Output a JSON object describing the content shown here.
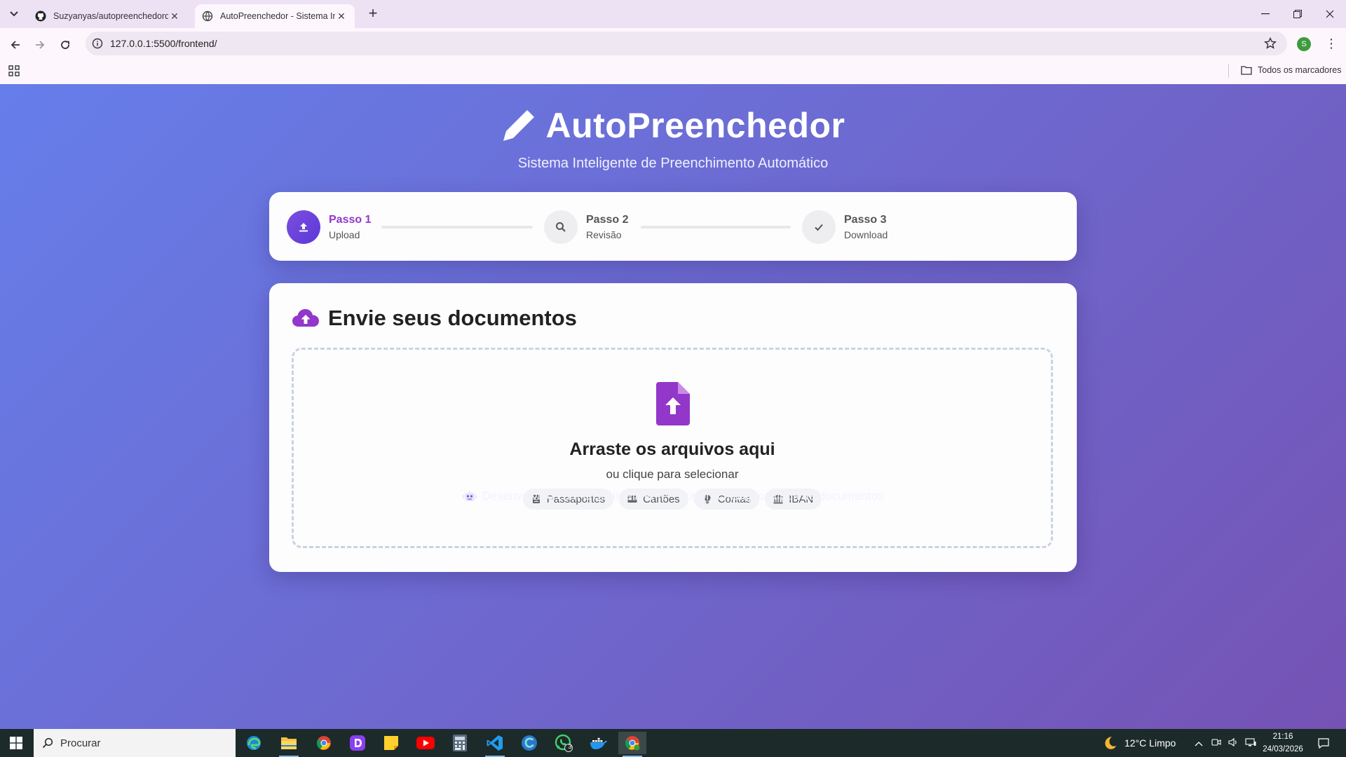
{
  "browser": {
    "tabs": [
      {
        "title": "Suzyanyas/autopreenchedordo...",
        "icon": "github-icon"
      },
      {
        "title": "AutoPreenchedor - Sistema Inte...",
        "icon": "globe-icon"
      }
    ],
    "url": "127.0.0.1:5500/frontend/",
    "profile_initial": "S",
    "bookmarks_all_label": "Todos os marcadores"
  },
  "app": {
    "title": "AutoPreenchedor",
    "subtitle": "Sistema Inteligente de Preenchimento Automático",
    "accent_color": "#9237c9"
  },
  "steps": [
    {
      "number": "Passo 1",
      "label": "Upload",
      "icon": "upload-icon",
      "active": true
    },
    {
      "number": "Passo 2",
      "label": "Revisão",
      "icon": "search-icon",
      "active": false
    },
    {
      "number": "Passo 3",
      "label": "Download",
      "icon": "check-icon",
      "active": false
    }
  ],
  "upload": {
    "section_title": "Envie seus documentos",
    "drop_title": "Arraste os arquivos aqui",
    "drop_subtitle": "ou clique para selecionar",
    "types": [
      {
        "label": "Passaportes",
        "icon": "passport-icon"
      },
      {
        "label": "Cartões",
        "icon": "id-card-icon"
      },
      {
        "label": "Contas",
        "icon": "lightbulb-icon"
      },
      {
        "label": "IBAN",
        "icon": "bank-icon"
      }
    ]
  },
  "footer": {
    "text": "Desenvolvido com OCR Inteligente • Suporta múltiplos tipos de documentos"
  },
  "taskbar": {
    "search_placeholder": "Procurar",
    "weather": "12°C  Limpo",
    "time": "21:16",
    "date": "24/03/2026",
    "whatsapp_badge": "3"
  }
}
